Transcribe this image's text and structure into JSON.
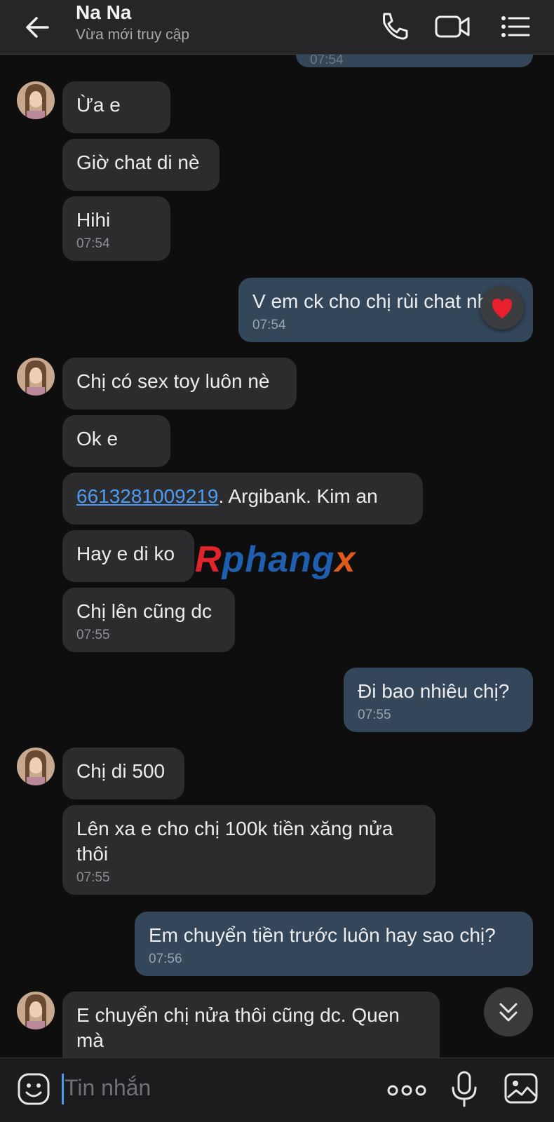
{
  "header": {
    "title": "Na Na",
    "status": "Vừa mới truy cập"
  },
  "messages": [
    {
      "text": "07:54"
    },
    {
      "text": "Ừa e"
    },
    {
      "text": "Giờ chat di nè"
    },
    {
      "text": "Hihi",
      "time": "07:54"
    },
    {
      "text": "V em ck cho chị rùi chat nha",
      "time": "07:54",
      "reaction": "heart"
    },
    {
      "text": "Chị có sex toy luôn nè"
    },
    {
      "text": "Ok e"
    },
    {
      "link": "6613281009219",
      "text": ". Argibank. Kim an"
    },
    {
      "text": "Hay e di ko"
    },
    {
      "text": "Chị lên cũng dc",
      "time": "07:55"
    },
    {
      "text": "Đi bao nhiêu chị?",
      "time": "07:55"
    },
    {
      "text": "Chị di 500"
    },
    {
      "text": "Lên xa e cho chị 100k tiền xăng nửa thôi",
      "time": "07:55"
    },
    {
      "text": "Em chuyển tiền trước luôn hay sao chị?",
      "time": "07:56"
    },
    {
      "text": "E chuyển chị nửa thôi cũng dc. Quen mà"
    }
  ],
  "watermark": {
    "part1": "R",
    "part2": "phang",
    "part3": "x"
  },
  "input": {
    "placeholder": "Tin nhắn"
  },
  "colors": {
    "background": "#0e0e0f",
    "incoming_bubble": "#2c2c2e",
    "outgoing_bubble": "#34465a",
    "link": "#4d9bf0",
    "header": "#262628"
  },
  "icons": [
    "back-arrow-icon",
    "phone-icon",
    "video-call-icon",
    "menu-list-icon",
    "heart-icon",
    "chevron-double-down-icon",
    "emoji-icon",
    "more-dots-icon",
    "microphone-icon",
    "image-icon"
  ]
}
